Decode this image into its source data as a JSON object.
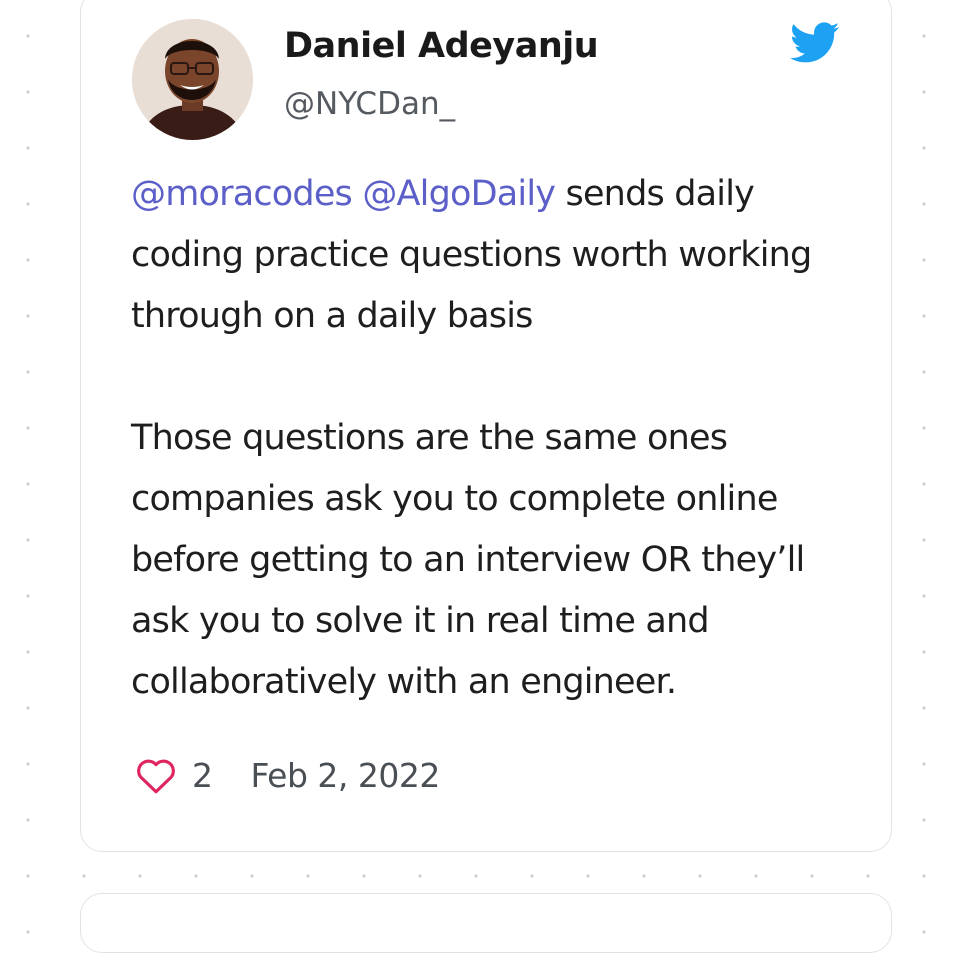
{
  "tweet": {
    "author": {
      "name": "Daniel Adeyanju",
      "handle": "@NYCDan_"
    },
    "body": {
      "paragraph1": {
        "mention1": "@moracodes",
        "mention2": "@AlgoDaily",
        "text": " sends daily coding practice questions worth working through on a daily basis"
      },
      "paragraph2": "Those questions are the same ones companies ask you to complete online before getting to an interview OR they’ll ask you to solve it in real time and collaboratively with an engineer."
    },
    "likes": "2",
    "date": "Feb 2, 2022"
  },
  "icons": {
    "brand": "twitter-bird-icon",
    "like": "heart-icon"
  },
  "colors": {
    "mention": "#5b5fc7",
    "twitter_blue": "#1da1f2",
    "like_red": "#e0245e",
    "text": "#1e1e1e",
    "secondary_text": "#555a60",
    "card_border": "#dfe3e8"
  }
}
